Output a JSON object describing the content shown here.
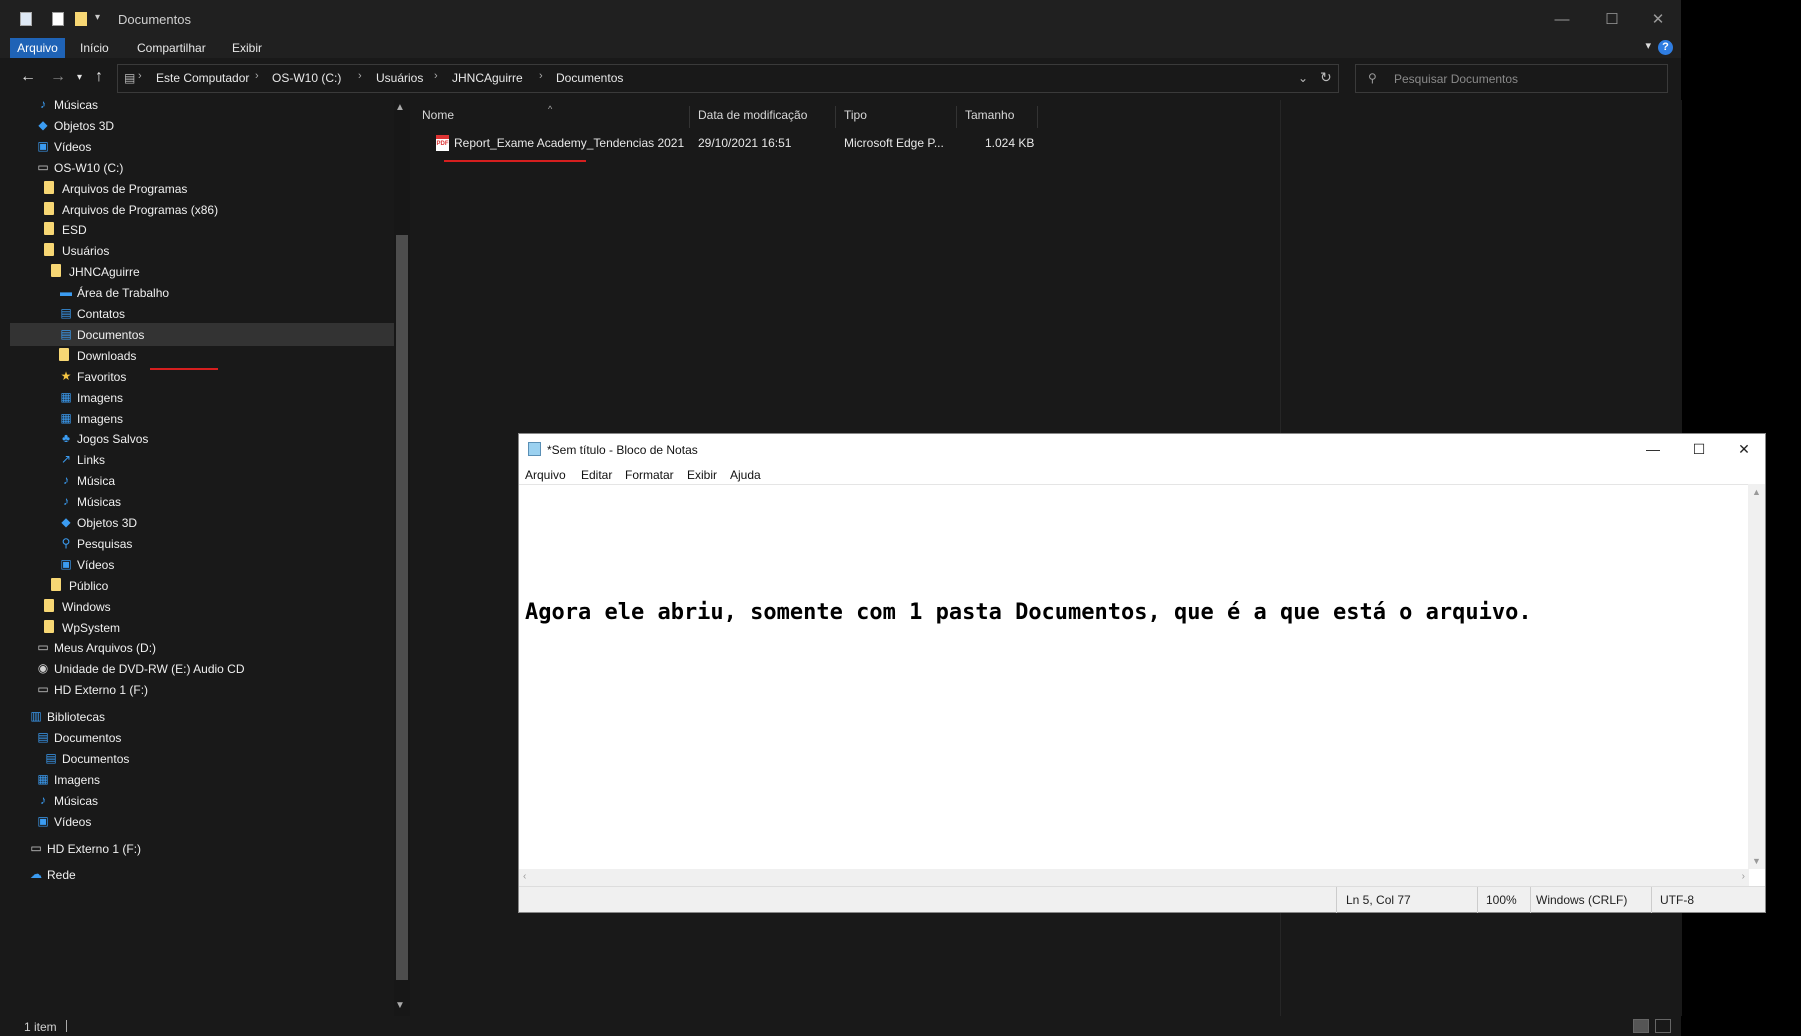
{
  "explorer": {
    "title": "Documentos",
    "ribbon_tabs": [
      "Arquivo",
      "Início",
      "Compartilhar",
      "Exibir"
    ],
    "help_label": "?",
    "breadcrumb": [
      "Este Computador",
      "OS-W10 (C:)",
      "Usuários",
      "JHNCAguirre",
      "Documentos"
    ],
    "search_placeholder": "Pesquisar Documentos",
    "nav_tree": [
      {
        "label": "Músicas",
        "icon": "music-icon"
      },
      {
        "label": "Objetos 3D",
        "icon": "cube-icon"
      },
      {
        "label": "Vídeos",
        "icon": "video-icon"
      },
      {
        "label": "OS-W10 (C:)",
        "icon": "drive-icon"
      },
      {
        "label": "Arquivos de Programas",
        "icon": "folder-icon"
      },
      {
        "label": "Arquivos de Programas (x86)",
        "icon": "folder-icon"
      },
      {
        "label": "ESD",
        "icon": "folder-icon"
      },
      {
        "label": "Usuários",
        "icon": "folder-icon"
      },
      {
        "label": "JHNCAguirre",
        "icon": "folder-icon"
      },
      {
        "label": "Área de Trabalho",
        "icon": "desktop-icon"
      },
      {
        "label": "Contatos",
        "icon": "contacts-icon"
      },
      {
        "label": "Documentos",
        "icon": "document-icon",
        "selected": true
      },
      {
        "label": "Downloads",
        "icon": "folder-icon"
      },
      {
        "label": "Favoritos",
        "icon": "star-icon"
      },
      {
        "label": "Imagens",
        "icon": "image-icon"
      },
      {
        "label": "Imagens",
        "icon": "image-icon"
      },
      {
        "label": "Jogos Salvos",
        "icon": "game-icon"
      },
      {
        "label": "Links",
        "icon": "link-icon"
      },
      {
        "label": "Música",
        "icon": "music-icon"
      },
      {
        "label": "Músicas",
        "icon": "music-icon"
      },
      {
        "label": "Objetos 3D",
        "icon": "cube-icon"
      },
      {
        "label": "Pesquisas",
        "icon": "search-icon"
      },
      {
        "label": "Vídeos",
        "icon": "video-icon"
      },
      {
        "label": "Público",
        "icon": "folder-icon"
      },
      {
        "label": "Windows",
        "icon": "folder-icon"
      },
      {
        "label": "WpSystem",
        "icon": "folder-icon"
      },
      {
        "label": "Meus Arquivos (D:)",
        "icon": "drive-icon"
      },
      {
        "label": "Unidade de DVD-RW (E:) Audio CD",
        "icon": "disc-icon"
      },
      {
        "label": "HD Externo 1 (F:)",
        "icon": "drive-icon"
      },
      {
        "label": "Bibliotecas",
        "icon": "library-icon"
      },
      {
        "label": "Documentos",
        "icon": "document-icon"
      },
      {
        "label": "Documentos",
        "icon": "document-icon"
      },
      {
        "label": "Imagens",
        "icon": "image-icon"
      },
      {
        "label": "Músicas",
        "icon": "music-icon"
      },
      {
        "label": "Vídeos",
        "icon": "video-icon"
      },
      {
        "label": "HD Externo 1 (F:)",
        "icon": "drive-icon"
      },
      {
        "label": "Rede",
        "icon": "network-icon"
      }
    ],
    "columns": [
      "Nome",
      "Data de modificação",
      "Tipo",
      "Tamanho"
    ],
    "files": [
      {
        "name": "Report_Exame Academy_Tendencias 2021",
        "modified": "29/10/2021 16:51",
        "type": "Microsoft Edge P...",
        "size": "1.024 KB",
        "icon": "pdf-icon"
      }
    ],
    "status": "1 item",
    "accent_color": "#1f63b6",
    "annotation_color": "#d61f1f"
  },
  "notepad": {
    "title": "*Sem título - Bloco de Notas",
    "menu": [
      "Arquivo",
      "Editar",
      "Formatar",
      "Exibir",
      "Ajuda"
    ],
    "content": "Agora ele abriu, somente com 1 pasta Documentos, que é a que está o arquivo.",
    "status": {
      "position": "Ln 5, Col 77",
      "zoom": "100%",
      "line_ending": "Windows (CRLF)",
      "encoding": "UTF-8"
    }
  }
}
